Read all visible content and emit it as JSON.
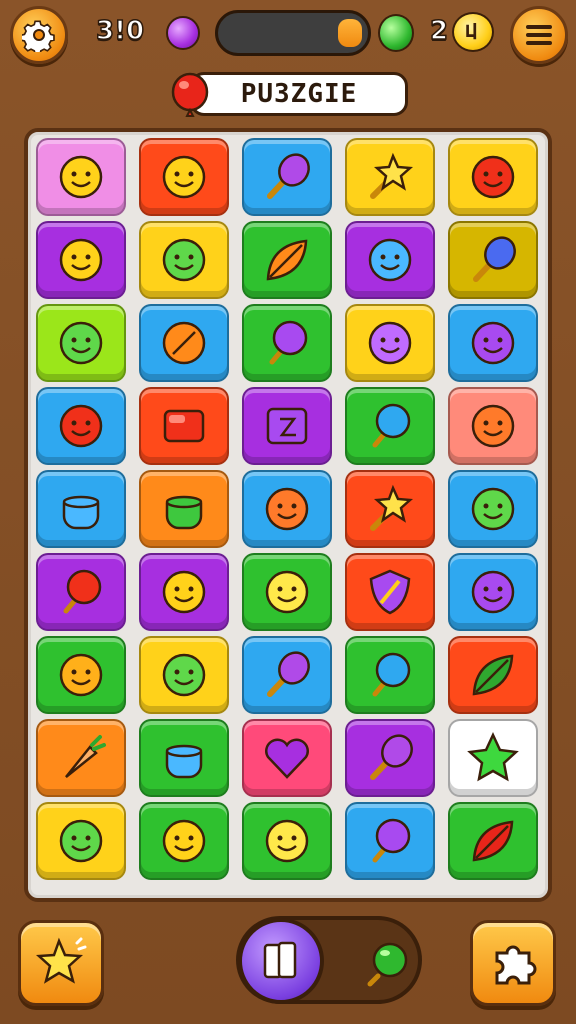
{
  "topbar": {
    "settings_icon": "gear-icon",
    "score_left": "3!0",
    "left_gem_color": "#a72fe0",
    "right_gem_color": "#2fb82f",
    "score_right": "2",
    "coin_icon": "coin-icon",
    "menu_icon": "hamburger-menu-icon"
  },
  "title": {
    "label": "PU3ZGIE",
    "icon": "red-balloon-icon"
  },
  "board": {
    "rows": [
      [
        {
          "bg": "#f08ee6",
          "icon": "smiley-face"
        },
        {
          "bg": "#ff4a1a",
          "icon": "smiley-face"
        },
        {
          "bg": "#2fa8f0",
          "icon": "purple-wand"
        },
        {
          "bg": "#ffd21a",
          "icon": "star-wand"
        },
        {
          "bg": "#ffd21a",
          "icon": "red-apple"
        }
      ],
      [
        {
          "bg": "#a72fe0",
          "icon": "smiley-face"
        },
        {
          "bg": "#ffd21a",
          "icon": "green-blob"
        },
        {
          "bg": "#2fc12f",
          "icon": "orange-leaf"
        },
        {
          "bg": "#a72fe0",
          "icon": "blue-potion"
        },
        {
          "bg": "#d6b600",
          "icon": "blue-leaf"
        }
      ],
      [
        {
          "bg": "#9be61a",
          "icon": "green-blob"
        },
        {
          "bg": "#2fa8f0",
          "icon": "orange-candy"
        },
        {
          "bg": "#2fc12f",
          "icon": "purple-lollipop"
        },
        {
          "bg": "#ffd21a",
          "icon": "purple-face"
        },
        {
          "bg": "#2fa8f0",
          "icon": "purple-monster"
        }
      ],
      [
        {
          "bg": "#2fa8f0",
          "icon": "red-blob"
        },
        {
          "bg": "#ff4a1a",
          "icon": "red-block"
        },
        {
          "bg": "#a72fe0",
          "icon": "purple-box"
        },
        {
          "bg": "#2fc12f",
          "icon": "blue-lollipop"
        },
        {
          "bg": "#ff8a7a",
          "icon": "orange-octopus"
        }
      ],
      [
        {
          "bg": "#2fa8f0",
          "icon": "blue-pot"
        },
        {
          "bg": "#ff8a1a",
          "icon": "green-pot"
        },
        {
          "bg": "#2fa8f0",
          "icon": "orange-octopus"
        },
        {
          "bg": "#ff4a1a",
          "icon": "star-wand"
        },
        {
          "bg": "#2fa8f0",
          "icon": "green-blob"
        }
      ],
      [
        {
          "bg": "#a72fe0",
          "icon": "red-balloon"
        },
        {
          "bg": "#a72fe0",
          "icon": "smiley-face"
        },
        {
          "bg": "#2fc12f",
          "icon": "yellow-face"
        },
        {
          "bg": "#ff4a1a",
          "icon": "purple-shield"
        },
        {
          "bg": "#2fa8f0",
          "icon": "purple-monster"
        }
      ],
      [
        {
          "bg": "#2fc12f",
          "icon": "orange-fruit"
        },
        {
          "bg": "#ffd21a",
          "icon": "green-blob"
        },
        {
          "bg": "#2fa8f0",
          "icon": "purple-wand"
        },
        {
          "bg": "#2fc12f",
          "icon": "blue-lollipop"
        },
        {
          "bg": "#ff4a1a",
          "icon": "green-leaf"
        }
      ],
      [
        {
          "bg": "#ff8a1a",
          "icon": "carrot"
        },
        {
          "bg": "#2fc12f",
          "icon": "blue-pot"
        },
        {
          "bg": "#ff4a7a",
          "icon": "heart"
        },
        {
          "bg": "#a72fe0",
          "icon": "purple-wand"
        },
        {
          "bg": "#ffffff",
          "icon": "green-star"
        }
      ],
      [
        {
          "bg": "#ffd21a",
          "icon": "green-blob"
        },
        {
          "bg": "#2fc12f",
          "icon": "smiley-face"
        },
        {
          "bg": "#2fc12f",
          "icon": "yellow-face"
        },
        {
          "bg": "#2fa8f0",
          "icon": "purple-lollipop"
        },
        {
          "bg": "#2fc12f",
          "icon": "red-leaf"
        }
      ]
    ]
  },
  "bottombar": {
    "left_button_icon": "star-hint-icon",
    "toggle_knob_icon": "pause-cards-icon",
    "toggle_indicator_icon": "green-lollipop-icon",
    "right_button_icon": "puzzle-piece-icon"
  }
}
